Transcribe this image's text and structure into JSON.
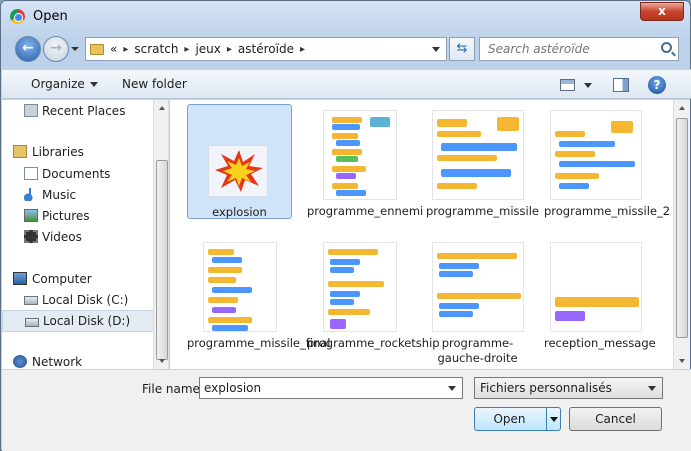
{
  "window": {
    "title": "Open",
    "close_label": "x"
  },
  "navigation": {
    "path": [
      "scratch",
      "jeux",
      "astéroïde"
    ],
    "overflow_marker": "«",
    "search_placeholder": "Search astéroïde"
  },
  "toolbar": {
    "organize": "Organize",
    "new_folder": "New folder",
    "help": "?"
  },
  "sidebar": {
    "items": [
      {
        "label": "Recent Places",
        "icon": "recent-places-icon"
      },
      {
        "label": "Libraries",
        "icon": "libraries-icon"
      },
      {
        "label": "Documents",
        "icon": "documents-icon"
      },
      {
        "label": "Music",
        "icon": "music-icon"
      },
      {
        "label": "Pictures",
        "icon": "pictures-icon"
      },
      {
        "label": "Videos",
        "icon": "videos-icon"
      },
      {
        "label": "Computer",
        "icon": "computer-icon"
      },
      {
        "label": "Local Disk (C:)",
        "icon": "disk-icon"
      },
      {
        "label": "Local Disk (D:)",
        "icon": "disk-icon",
        "selected": true
      },
      {
        "label": "Network",
        "icon": "network-icon"
      }
    ]
  },
  "files": [
    {
      "name": "explosion",
      "type": "image",
      "selected": true
    },
    {
      "name": "programme_ennemi",
      "type": "scratch-code"
    },
    {
      "name": "programme_missile",
      "type": "scratch-code"
    },
    {
      "name": "programme_missile_2",
      "type": "scratch-code"
    },
    {
      "name": "programme_missile_final",
      "type": "scratch-code"
    },
    {
      "name": "programme_rocketship",
      "type": "scratch-code"
    },
    {
      "name": "programme-gauche-droite",
      "type": "scratch-code"
    },
    {
      "name": "reception_message",
      "type": "scratch-code"
    }
  ],
  "footer": {
    "file_name_label": "File name:",
    "file_name_value": "explosion",
    "file_type": "Fichiers personnalisés",
    "open_label": "Open",
    "cancel_label": "Cancel"
  },
  "colors": {
    "selection": "#cfe3f9",
    "scratch_events": "#f5b731",
    "scratch_motion": "#4c97ff",
    "scratch_looks": "#9966ff"
  }
}
